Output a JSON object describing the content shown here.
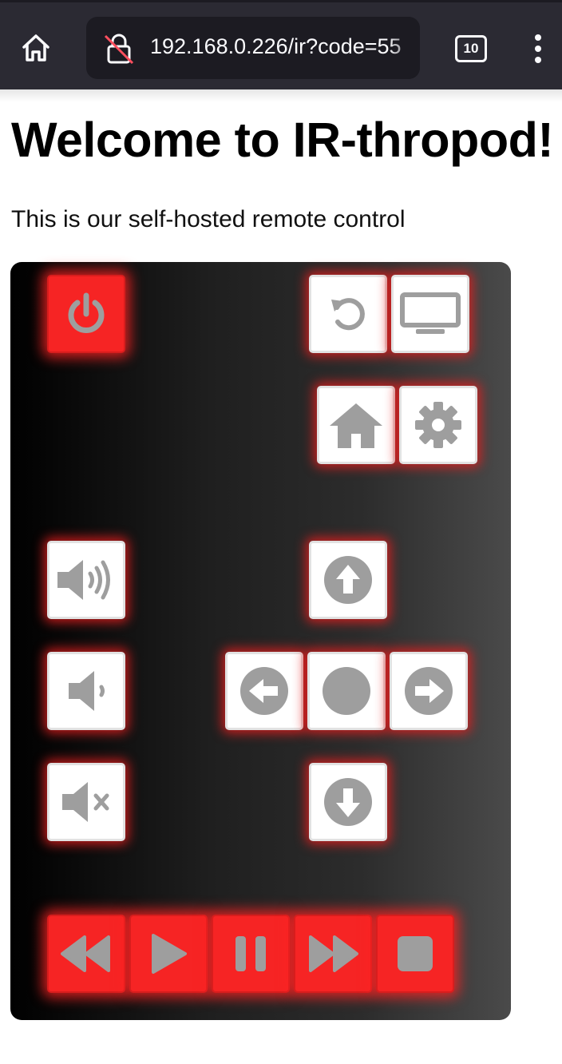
{
  "browser": {
    "url": "192.168.0.226/ir?code=55",
    "tab_count": "10"
  },
  "page": {
    "heading": "Welcome to IR-thropod!",
    "intro": "This is our self-hosted remote control"
  },
  "remote": {
    "colors": {
      "accent": "#f62424",
      "icon": "#9e9e9e",
      "button_face": "#ffffff",
      "glow": "#e61e1e"
    },
    "buttons": [
      {
        "name": "power-button",
        "icon": "power-icon",
        "style": "red"
      },
      {
        "name": "back-button",
        "icon": "undo-icon",
        "style": "white"
      },
      {
        "name": "input-tv-button",
        "icon": "tv-icon",
        "style": "white"
      },
      {
        "name": "home-button",
        "icon": "house-icon",
        "style": "white"
      },
      {
        "name": "settings-button",
        "icon": "gear-icon",
        "style": "white"
      },
      {
        "name": "volume-up-button",
        "icon": "volume-high-icon",
        "style": "white"
      },
      {
        "name": "volume-down-button",
        "icon": "volume-low-icon",
        "style": "white"
      },
      {
        "name": "mute-button",
        "icon": "volume-mute-icon",
        "style": "white"
      },
      {
        "name": "dpad-up-button",
        "icon": "arrow-up-circle-icon",
        "style": "white"
      },
      {
        "name": "dpad-left-button",
        "icon": "arrow-left-circle-icon",
        "style": "white"
      },
      {
        "name": "dpad-ok-button",
        "icon": "circle-icon",
        "style": "white"
      },
      {
        "name": "dpad-right-button",
        "icon": "arrow-right-circle-icon",
        "style": "white"
      },
      {
        "name": "dpad-down-button",
        "icon": "arrow-down-circle-icon",
        "style": "white"
      },
      {
        "name": "rewind-button",
        "icon": "rewind-icon",
        "style": "red"
      },
      {
        "name": "play-button",
        "icon": "play-icon",
        "style": "red"
      },
      {
        "name": "pause-button",
        "icon": "pause-icon",
        "style": "red"
      },
      {
        "name": "fast-forward-button",
        "icon": "fast-forward-icon",
        "style": "red"
      },
      {
        "name": "stop-button",
        "icon": "stop-icon",
        "style": "red"
      }
    ]
  }
}
